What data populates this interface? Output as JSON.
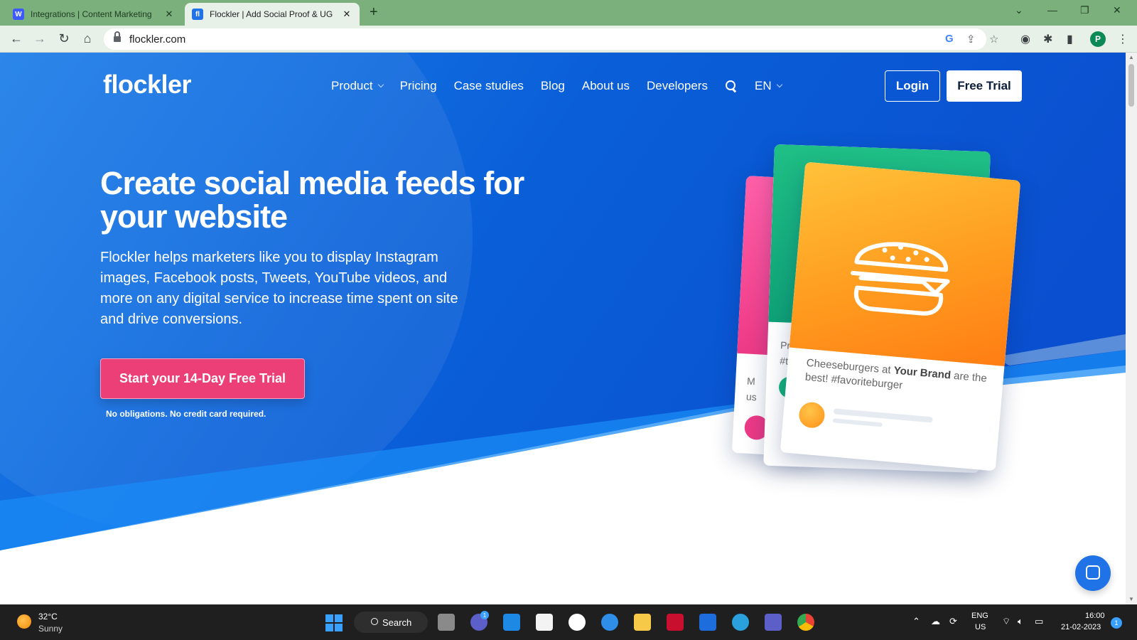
{
  "browser": {
    "tabs": [
      {
        "title": "Integrations | Content Marketing",
        "favicon": "W",
        "active": false
      },
      {
        "title": "Flockler | Add Social Proof & UG",
        "favicon": "fl",
        "active": true
      }
    ],
    "url": "flockler.com",
    "profile_initial": "P"
  },
  "site": {
    "logo": "flockler",
    "nav": {
      "product": "Product",
      "pricing": "Pricing",
      "case_studies": "Case studies",
      "blog": "Blog",
      "about": "About us",
      "developers": "Developers",
      "language": "EN"
    },
    "login": "Login",
    "free_trial": "Free Trial"
  },
  "hero": {
    "headline": "Create social media feeds for your website",
    "subtext": "Flockler helps marketers like you to display Instagram images, Facebook posts, Tweets, YouTube videos, and more on any digital service to increase time spent on site and drive conversions.",
    "cta": "Start your 14-Day Free Trial",
    "cta_note": "No obligations. No credit card required."
  },
  "cards": {
    "caption_pre": "Cheeseburgers at ",
    "caption_brand": "Your Brand",
    "caption_post": " are the best! #favoriteburger",
    "green_peek_1": "Pra",
    "green_peek_2": "#te",
    "pink_peek_1": "M",
    "pink_peek_2": "us"
  },
  "taskbar": {
    "temp": "32°C",
    "condition": "Sunny",
    "search": "Search",
    "lang_1": "ENG",
    "lang_2": "US",
    "time": "16:00",
    "date": "21-02-2023",
    "notifications": "1",
    "meet_badge": "1"
  },
  "colors": {
    "hero_blue": "#1f73e6",
    "cta_pink": "#ec3e77",
    "tab_bar": "#7bb07d"
  }
}
